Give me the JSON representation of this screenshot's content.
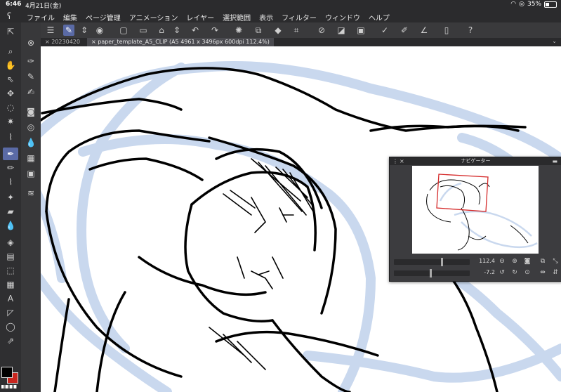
{
  "status": {
    "time": "6:46",
    "date": "4月21日(金)",
    "battery": "35%"
  },
  "app": {
    "logo": "clip-studio-logo"
  },
  "menu": [
    "ファイル",
    "編集",
    "ページ管理",
    "アニメーション",
    "レイヤー",
    "選択範囲",
    "表示",
    "フィルター",
    "ウィンドウ",
    "ヘルプ"
  ],
  "tabs": [
    {
      "label": "20230420",
      "active": false
    },
    {
      "label": "paper_template_A5_CLIP (A5 4961 x 3496px 600dpi 112.4%)",
      "active": true
    }
  ],
  "navigator": {
    "title": "ナビゲーター",
    "zoom_value": "112.4",
    "zoom_fraction": 0.62,
    "rotate_value": "-7.2",
    "rotate_fraction": 0.47
  },
  "colors": {
    "main": "#000000",
    "sub": "#c8261f",
    "accent": "#5a6aa5",
    "sketch_blue": "#c9d8ee"
  }
}
